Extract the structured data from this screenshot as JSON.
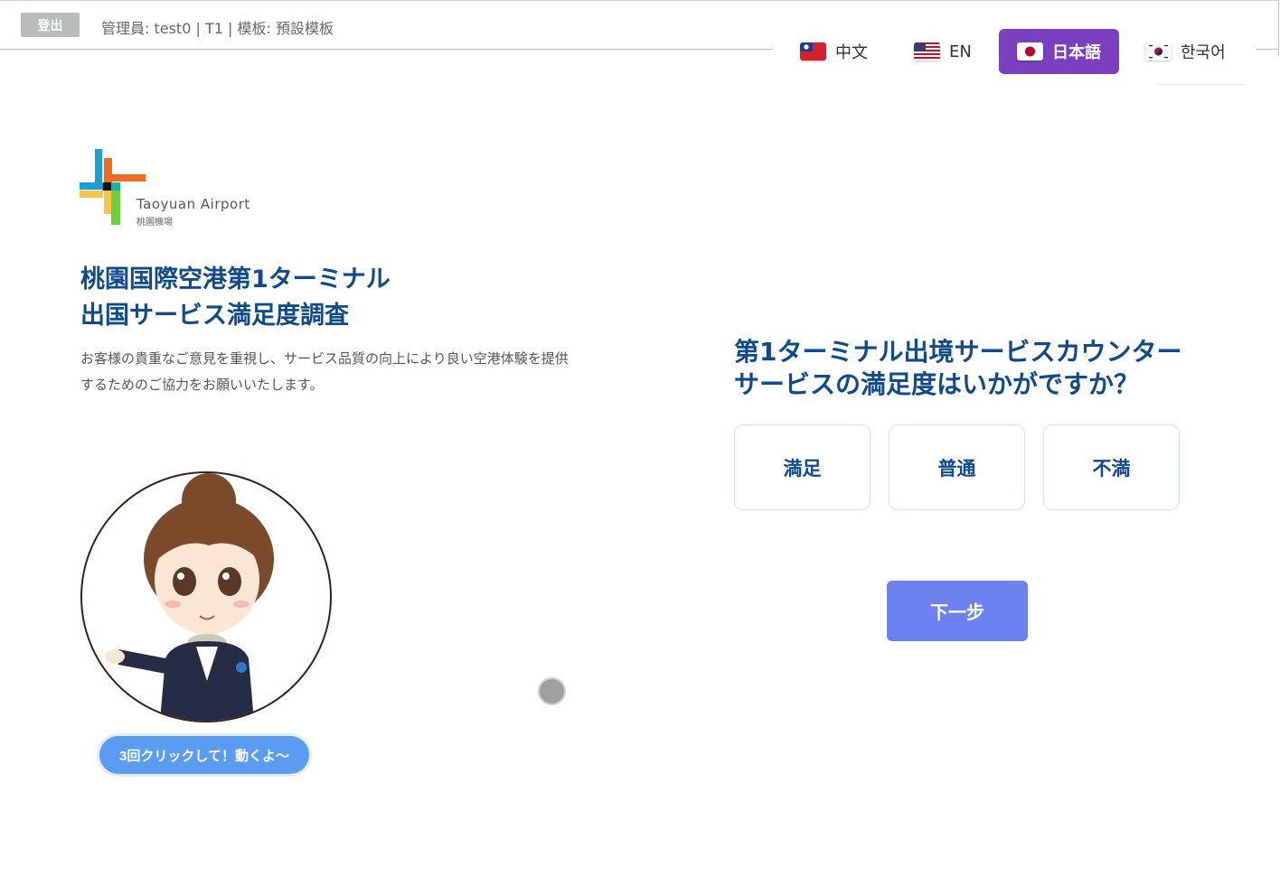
{
  "header": {
    "logout_label": "登出",
    "admin_info": "管理員: test0 | T1 | 模板: 預設模板"
  },
  "languages": [
    {
      "label": "中文",
      "flag": "taiwan-flag-icon",
      "active": false
    },
    {
      "label": "EN",
      "flag": "us-flag-icon",
      "active": false
    },
    {
      "label": "日本語",
      "flag": "japan-flag-icon",
      "active": true
    },
    {
      "label": "한국어",
      "flag": "korea-flag-icon",
      "active": false
    }
  ],
  "logo": {
    "name": "Taoyuan Airport",
    "subname": "桃園機場"
  },
  "survey": {
    "title_line1": "桃園国際空港第1ターミナル",
    "title_line2": "出国サービス満足度調査",
    "description": "お客様の貴重なご意見を重視し、サービス品質の向上により良い空港体験を提供するためのご協力をお願いいたします。"
  },
  "mascot": {
    "tip": "3回クリックして！動くよ～"
  },
  "question": {
    "text": "第1ターミナル出境サービスカウンターサービスの満足度はいかがですか？",
    "options": [
      "満足",
      "普通",
      "不満"
    ]
  },
  "next_label": "下一步",
  "colors": {
    "brand_blue": "#0f4a8a",
    "active_lang": "#7b3fbf",
    "next_button": "#6b82ef",
    "tip_button": "#5b9cf3",
    "logout_button": "#b9bcbd"
  }
}
